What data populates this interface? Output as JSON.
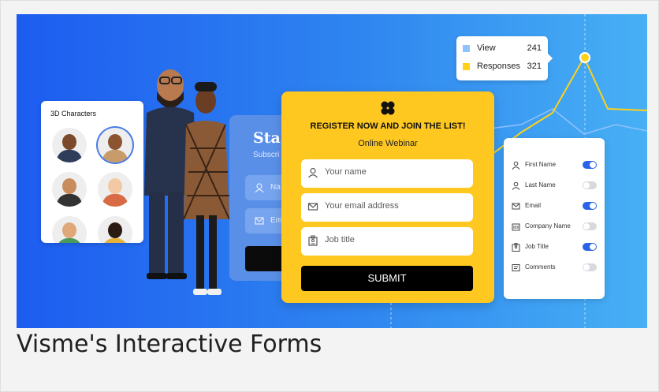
{
  "caption": "Visme's Interactive Forms",
  "chars_card": {
    "title": "3D Characters"
  },
  "bg_card": {
    "title": "Sta",
    "subtitle": "Subscri",
    "field1": "Na",
    "field2": "Em"
  },
  "register": {
    "title": "REGISTER NOW AND JOIN THE LIST!",
    "subtitle": "Online Webinar",
    "fields": [
      {
        "icon": "user-icon",
        "placeholder": "Your name"
      },
      {
        "icon": "mail-icon",
        "placeholder": "Your email address"
      },
      {
        "icon": "badge-icon",
        "placeholder": "Job title"
      }
    ],
    "submit": "SUBMIT"
  },
  "fields_panel": {
    "items": [
      {
        "label": "First Name",
        "icon": "user-icon",
        "on": true
      },
      {
        "label": "Last Name",
        "icon": "user-icon",
        "on": false
      },
      {
        "label": "Email",
        "icon": "mail-icon",
        "on": true
      },
      {
        "label": "Company Name",
        "icon": "building-icon",
        "on": false
      },
      {
        "label": "Job Title",
        "icon": "badge-icon",
        "on": true
      },
      {
        "label": "Comments",
        "icon": "comment-icon",
        "on": false
      }
    ]
  },
  "legend": {
    "items": [
      {
        "name": "View",
        "value": "241",
        "color": "#8fc2ff"
      },
      {
        "name": "Responses",
        "value": "321",
        "color": "#ffd21a"
      }
    ]
  },
  "colors": {
    "hero_start": "#1d5cf0",
    "hero_end": "#47b0f4",
    "form_yellow": "#ffc821",
    "toggle_on": "#2a63e8"
  }
}
